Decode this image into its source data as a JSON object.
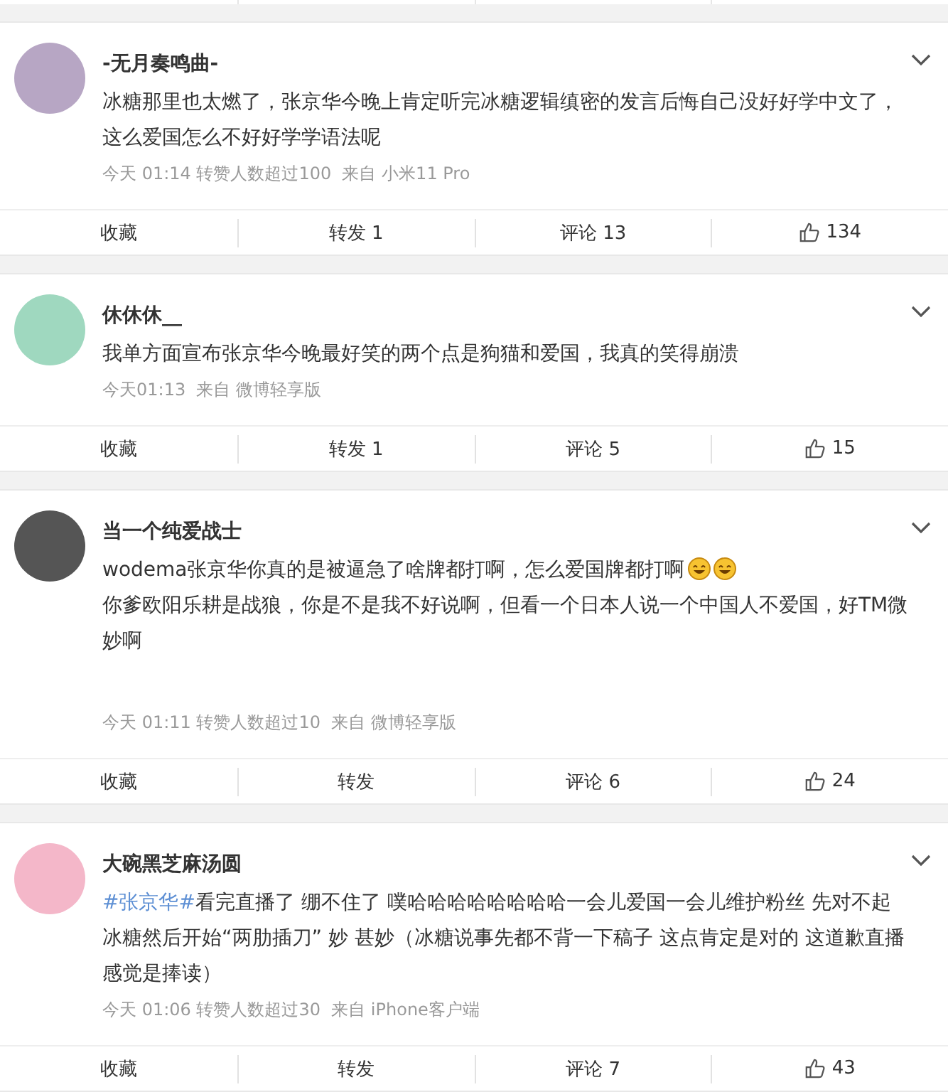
{
  "posts": [
    {
      "author": "-无月奏鸣曲-",
      "body": [
        {
          "kind": "text",
          "text": "冰糖那里也太燃了，张京华今晚上肯定听完冰糖逻辑缜密的发言后悔自己没好好学中文了，这么爱国怎么不好好学学语法呢"
        }
      ],
      "meta": "今天 01:14 转赞人数超过100  来自 小米11 Pro",
      "actions": {
        "favorite": "收藏",
        "repost": "转发 1",
        "comment": "评论 13",
        "likes": "134"
      }
    },
    {
      "author": "休休休__",
      "body": [
        {
          "kind": "text",
          "text": "我单方面宣布张京华今晚最好笑的两个点是狗猫和爱国，我真的笑得崩溃"
        }
      ],
      "meta": "今天01:13  来自 微博轻享版",
      "actions": {
        "favorite": "收藏",
        "repost": "转发 1",
        "comment": "评论 5",
        "likes": "15"
      }
    },
    {
      "author": "当一个纯爱战士",
      "body": [
        {
          "kind": "text",
          "text": "wodema张京华你真的是被逼急了啥牌都打啊，怎么爱国牌都打啊"
        },
        {
          "kind": "emoji"
        },
        {
          "kind": "emoji"
        },
        {
          "kind": "break"
        },
        {
          "kind": "text",
          "text": "你爹欧阳乐耕是战狼，你是不是我不好说啊，但看一个日本人说一个中国人不爱国，好TM微妙啊"
        }
      ],
      "meta": "今天 01:11 转赞人数超过10  来自 微博轻享版",
      "actions": {
        "favorite": "收藏",
        "repost": "转发",
        "comment": "评论 6",
        "likes": "24"
      }
    },
    {
      "author": "大碗黑芝麻汤圆",
      "body": [
        {
          "kind": "hashtag",
          "text": "#张京华#"
        },
        {
          "kind": "text",
          "text": "看完直播了 绷不住了 噗哈哈哈哈哈哈哈哈一会儿爱国一会儿维护粉丝 先对不起冰糖然后开始“两肋插刀” 妙 甚妙（冰糖说事先都不背一下稿子 这点肯定是对的 这道歉直播感觉是捧读）"
        }
      ],
      "meta": "今天 01:06 转赞人数超过30  来自 iPhone客户端",
      "actions": {
        "favorite": "收藏",
        "repost": "转发",
        "comment": "评论 7",
        "likes": "43"
      }
    }
  ]
}
